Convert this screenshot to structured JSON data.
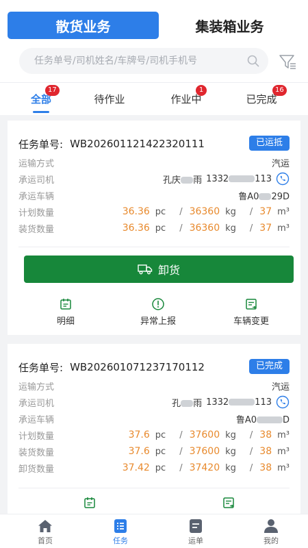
{
  "business_tabs": {
    "active": "散货业务",
    "inactive": "集装箱业务"
  },
  "search": {
    "placeholder": "任务单号/司机姓名/车牌号/司机手机号"
  },
  "status_tabs": [
    {
      "label": "全部",
      "badge": "17"
    },
    {
      "label": "待作业",
      "badge": ""
    },
    {
      "label": "作业中",
      "badge": "1"
    },
    {
      "label": "已完成",
      "badge": "16"
    }
  ],
  "cards": [
    {
      "order_label": "任务单号:",
      "order_no": "WB202601121422320111",
      "status": "已运抵",
      "transport_label": "运输方式",
      "transport_value": "汽运",
      "driver_label": "承运司机",
      "driver_name_a": "孔庆",
      "driver_name_b": "雨",
      "driver_phone_a": "1332",
      "driver_phone_b": "113",
      "vehicle_label": "承运车辆",
      "vehicle_plate_a": "鲁A0",
      "vehicle_plate_b": "29D",
      "plan_label": "计划数量",
      "plan": {
        "pc": "36.36",
        "kg": "36360",
        "m3": "37"
      },
      "load_label": "装货数量",
      "load": {
        "pc": "36.36",
        "kg": "36360",
        "m3": "37"
      },
      "unload_button": "卸货",
      "actions": [
        "明细",
        "异常上报",
        "车辆变更"
      ]
    },
    {
      "order_label": "任务单号:",
      "order_no": "WB202601071237170112",
      "status": "已完成",
      "transport_label": "运输方式",
      "transport_value": "汽运",
      "driver_label": "承运司机",
      "driver_name_a": "孔",
      "driver_name_b": "雨",
      "driver_phone_a": "1332",
      "driver_phone_b": "113",
      "vehicle_label": "承运车辆",
      "vehicle_plate_a": "鲁A0",
      "vehicle_plate_b": "D",
      "plan_label": "计划数量",
      "plan": {
        "pc": "37.6",
        "kg": "37600",
        "m3": "38"
      },
      "load_label": "装货数量",
      "load": {
        "pc": "37.6",
        "kg": "37600",
        "m3": "38"
      },
      "unload_label": "卸货数量",
      "unload": {
        "pc": "37.42",
        "kg": "37420",
        "m3": "38"
      }
    }
  ],
  "units": {
    "pc": "pc",
    "kg": "kg",
    "m3": "m³",
    "slash": "/"
  },
  "bottom_nav": [
    {
      "label": "首页",
      "icon": "home-icon"
    },
    {
      "label": "任务",
      "icon": "task-icon"
    },
    {
      "label": "运单",
      "icon": "waybill-icon"
    },
    {
      "label": "我的",
      "icon": "profile-icon"
    }
  ],
  "colors": {
    "primary": "#2d7ee8",
    "green": "#17873a",
    "orange": "#e8892c",
    "badge": "#e0262e"
  }
}
